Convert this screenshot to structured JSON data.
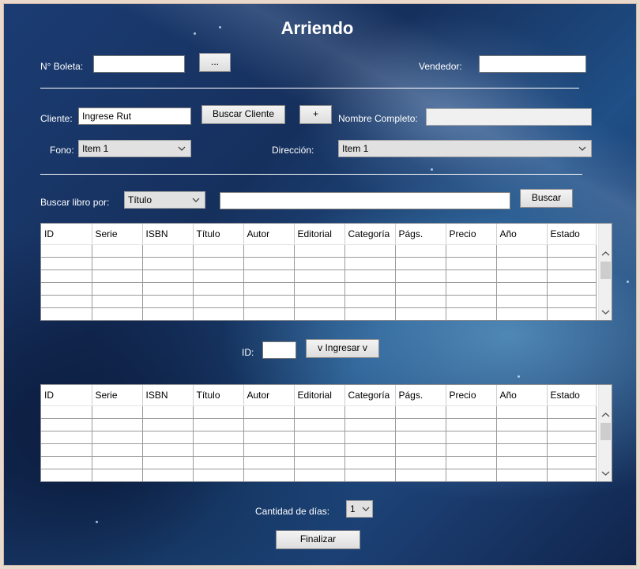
{
  "title": "Arriendo",
  "boleta": {
    "label": "N° Boleta:",
    "value": "",
    "browse_label": "..."
  },
  "vendedor": {
    "label": "Vendedor:",
    "value": ""
  },
  "cliente": {
    "label": "Cliente:",
    "value": "Ingrese Rut",
    "search_button": "Buscar Cliente",
    "add_button": "+",
    "name_label": "Nombre Completo:",
    "name_value": ""
  },
  "fono": {
    "label": "Fono:",
    "selected": "Item 1"
  },
  "direccion": {
    "label": "Dirección:",
    "selected": "Item 1"
  },
  "search": {
    "label": "Buscar libro por:",
    "field_selected": "Título",
    "query": "",
    "button": "Buscar"
  },
  "columns": [
    "ID",
    "Serie",
    "ISBN",
    "Título",
    "Autor",
    "Editorial",
    "Categoría",
    "Págs.",
    "Precio",
    "Año",
    "Estado"
  ],
  "ingreso": {
    "label": "ID:",
    "value": "",
    "button": "v Ingresar v"
  },
  "dias": {
    "label": "Cantidad de días:",
    "selected": "1"
  },
  "finalizar": "Finalizar",
  "colors": {
    "background": "#1b3c73",
    "button": "#e1e1e1",
    "text": "#ffffff"
  },
  "icons": [
    "chevron-down-icon",
    "scroll-up-icon",
    "scroll-down-icon"
  ]
}
